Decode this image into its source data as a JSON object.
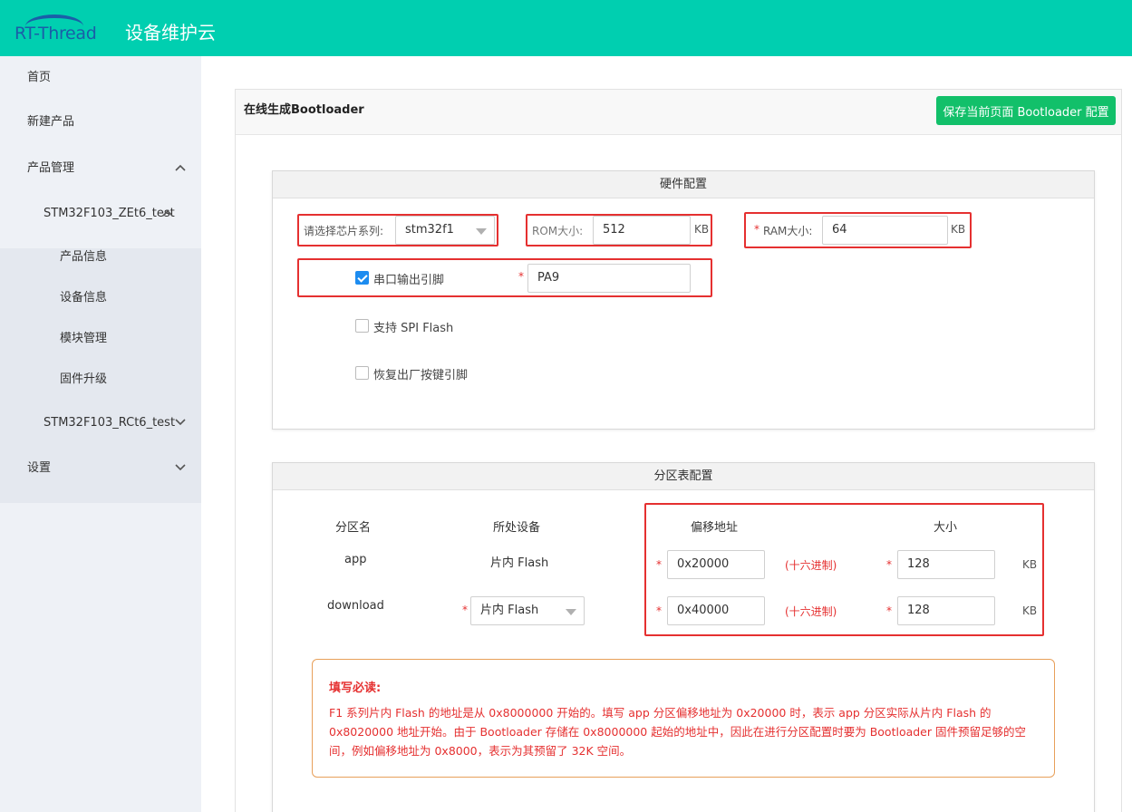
{
  "app": {
    "logo_text": "RT-Thread",
    "title": "设备维护云"
  },
  "sidebar": {
    "items": [
      {
        "label": "首页"
      },
      {
        "label": "新建产品"
      },
      {
        "label": "产品管理"
      },
      {
        "label": "STM32F103_ZEt6_test"
      },
      {
        "label": "产品信息"
      },
      {
        "label": "设备信息"
      },
      {
        "label": "模块管理"
      },
      {
        "label": "固件升级"
      },
      {
        "label": "STM32F103_RCt6_test"
      },
      {
        "label": "设置"
      }
    ]
  },
  "page": {
    "title": "在线生成Bootloader",
    "save_button": "保存当前页面 Bootloader 配置"
  },
  "hardware": {
    "heading": "硬件配置",
    "chip_label": "请选择芯片系列:",
    "chip_value": "stm32f1",
    "rom_label": "ROM大小:",
    "rom_value": "512",
    "rom_unit": "KB",
    "ram_required": "*",
    "ram_label": "RAM大小:",
    "ram_value": "64",
    "ram_unit": "KB",
    "uart_label": "串口输出引脚",
    "uart_checked": true,
    "uart_required": "*",
    "uart_value": "PA9",
    "spi_label": "支持 SPI Flash",
    "spi_checked": false,
    "reset_label": "恢复出厂按键引脚",
    "reset_checked": false
  },
  "partition": {
    "heading": "分区表配置",
    "columns": [
      "分区名",
      "所处设备",
      "偏移地址",
      "大小"
    ],
    "rows": [
      {
        "name": "app",
        "device": "片内 Flash",
        "offset": "0x20000",
        "hex_note": "(十六进制)",
        "size": "128",
        "unit": "KB"
      },
      {
        "name": "download",
        "device": "片内 Flash",
        "offset": "0x40000",
        "hex_note": "(十六进制)",
        "size": "128",
        "unit": "KB"
      }
    ],
    "required": "*"
  },
  "notice": {
    "title": "填写必读:",
    "body": "F1 系列片内 Flash 的地址是从 0x8000000 开始的。填写 app 分区偏移地址为 0x20000 时，表示 app 分区实际从片内 Flash 的 0x8020000 地址开始。由于 Bootloader 存储在 0x8000000 起始的地址中，因此在进行分区配置时要为 Bootloader 固件预留足够的空间，例如偏移地址为 0x8000，表示为其预留了 32K 空间。"
  },
  "colors": {
    "topbar": "#00cfb0",
    "save_button": "#12c06a",
    "highlight": "#e53030",
    "logo": "#1a5ea8",
    "checkbox": "#1d8cf0"
  }
}
